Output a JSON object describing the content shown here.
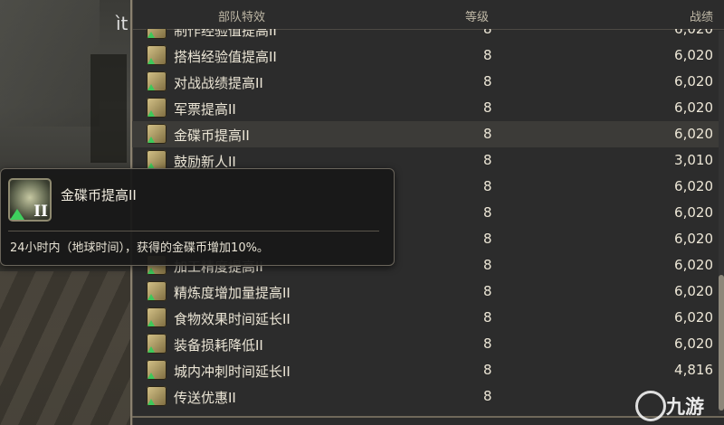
{
  "background": {
    "partial_text": "ìt"
  },
  "header": {
    "col_effect": "部队特效",
    "col_level": "等级",
    "col_score": "战绩"
  },
  "rows": [
    {
      "name": "制作经验值提高II",
      "level": "8",
      "score": "6,020",
      "icon": "craft-exp-icon"
    },
    {
      "name": "搭档经验值提高II",
      "level": "8",
      "score": "6,020",
      "icon": "partner-exp-icon"
    },
    {
      "name": "对战战绩提高II",
      "level": "8",
      "score": "6,020",
      "icon": "pvp-record-icon"
    },
    {
      "name": "军票提高II",
      "level": "8",
      "score": "6,020",
      "icon": "seal-icon"
    },
    {
      "name": "金碟币提高II",
      "level": "8",
      "score": "6,020",
      "icon": "mgp-icon"
    },
    {
      "name": "鼓励新人II",
      "level": "8",
      "score": "3,010",
      "icon": "newbie-icon"
    },
    {
      "name": "",
      "level": "8",
      "score": "6,020",
      "icon": ""
    },
    {
      "name": "",
      "level": "8",
      "score": "6,020",
      "icon": ""
    },
    {
      "name": "",
      "level": "8",
      "score": "6,020",
      "icon": ""
    },
    {
      "name": "加工精度提高II",
      "level": "8",
      "score": "6,020",
      "icon": "precision-icon"
    },
    {
      "name": "精炼度增加量提高II",
      "level": "8",
      "score": "6,020",
      "icon": "spiritbond-icon"
    },
    {
      "name": "食物效果时间延长II",
      "level": "8",
      "score": "6,020",
      "icon": "food-icon"
    },
    {
      "name": "装备损耗降低II",
      "level": "8",
      "score": "6,020",
      "icon": "gear-wear-icon"
    },
    {
      "name": "城内冲刺时间延长II",
      "level": "8",
      "score": "4,816",
      "icon": "sprint-icon"
    },
    {
      "name": "传送优惠II",
      "level": "8",
      "score": "",
      "icon": "teleport-icon"
    }
  ],
  "tooltip": {
    "title": "金碟币提高II",
    "rank": "II",
    "description": "24小时内（地球时间），获得的金碟币增加10%。"
  },
  "watermark": {
    "text": "九游"
  }
}
